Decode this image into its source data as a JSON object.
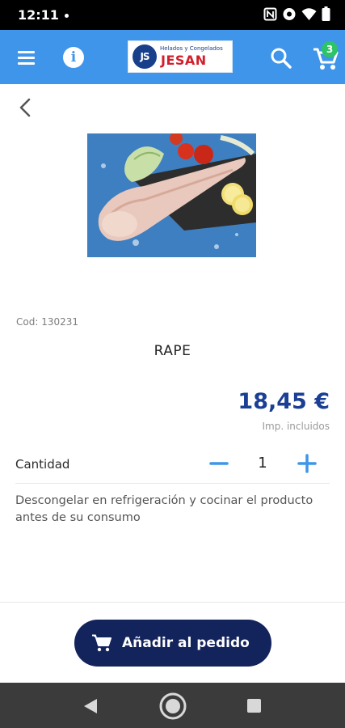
{
  "status_bar": {
    "time": "12:11",
    "icons": [
      "nfc-icon",
      "eye-icon",
      "wifi-icon",
      "battery-icon"
    ]
  },
  "app_bar": {
    "background_color": "#3f95e9",
    "logo": {
      "mark": "JS",
      "tagline": "Helados y Congelados",
      "name": "JESAN"
    },
    "cart_count": "3",
    "cart_badge_color": "#2ec366",
    "icons": [
      "menu-icon",
      "info-icon",
      "search-icon",
      "cart-icon"
    ]
  },
  "product": {
    "code": "Cod: 130231",
    "name": "RAPE",
    "price": "18,45 €",
    "price_color": "#1a3f94",
    "tax_note": "Imp. incluidos",
    "quantity_label": "Cantidad",
    "quantity": "1",
    "description": "Descongelar en refrigeración y cocinar el producto antes de su consumo"
  },
  "add_button": {
    "label": "Añadir al pedido",
    "color": "#13235c"
  },
  "nav_bar": {
    "icons": [
      "back-triangle-icon",
      "home-circle-icon",
      "recents-square-icon"
    ]
  }
}
